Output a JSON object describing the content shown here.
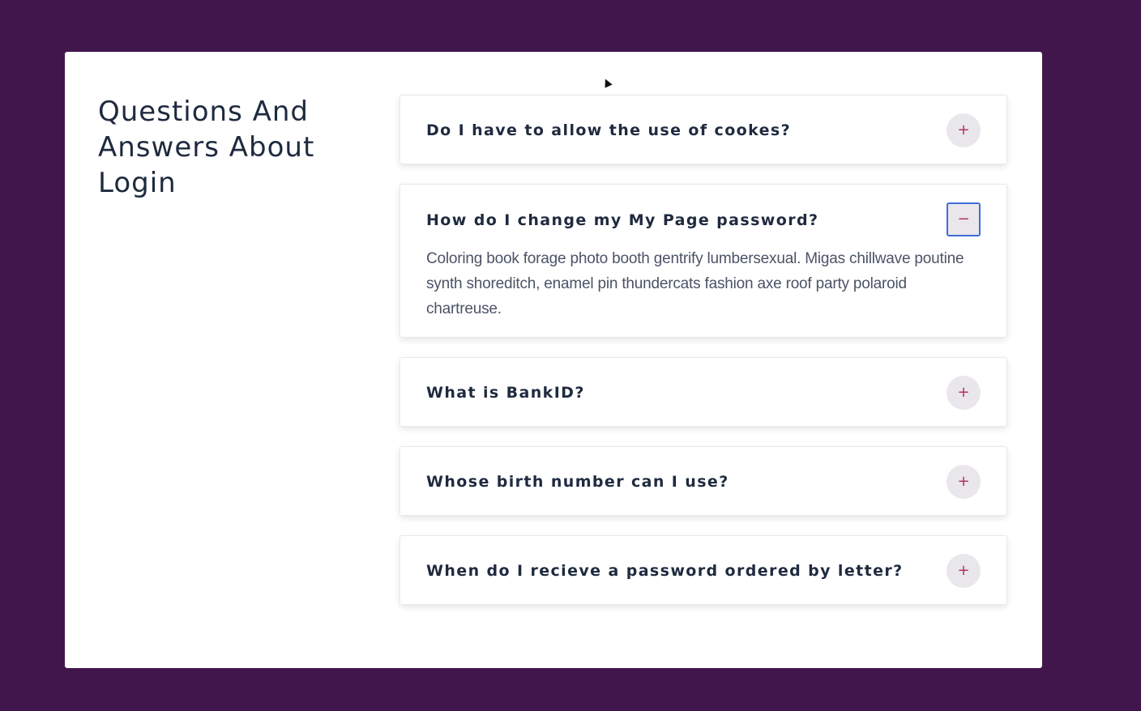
{
  "page": {
    "title": "Questions And Answers About Login"
  },
  "faq": {
    "items": [
      {
        "question": "Do I have to allow the use of cookes?",
        "expanded": false,
        "toggle": "+"
      },
      {
        "question": "How do I change my My Page password?",
        "expanded": true,
        "toggle": "−",
        "answer": "Coloring book forage photo booth gentrify lumbersexual. Migas chillwave poutine synth shoreditch, enamel pin thundercats fashion axe roof party polaroid chartreuse."
      },
      {
        "question": "What is BankID?",
        "expanded": false,
        "toggle": "+"
      },
      {
        "question": "Whose birth number can I use?",
        "expanded": false,
        "toggle": "+"
      },
      {
        "question": "When do I recieve a password ordered by letter?",
        "expanded": false,
        "toggle": "+"
      }
    ]
  },
  "colors": {
    "background": "#41164d",
    "card": "#ffffff",
    "heading": "#1f2a3f",
    "accent": "#b3325e",
    "focus": "#3f6fd8"
  },
  "icons": {
    "expand": "plus-icon",
    "collapse": "minus-icon",
    "cursor": "mouse-cursor-icon"
  }
}
